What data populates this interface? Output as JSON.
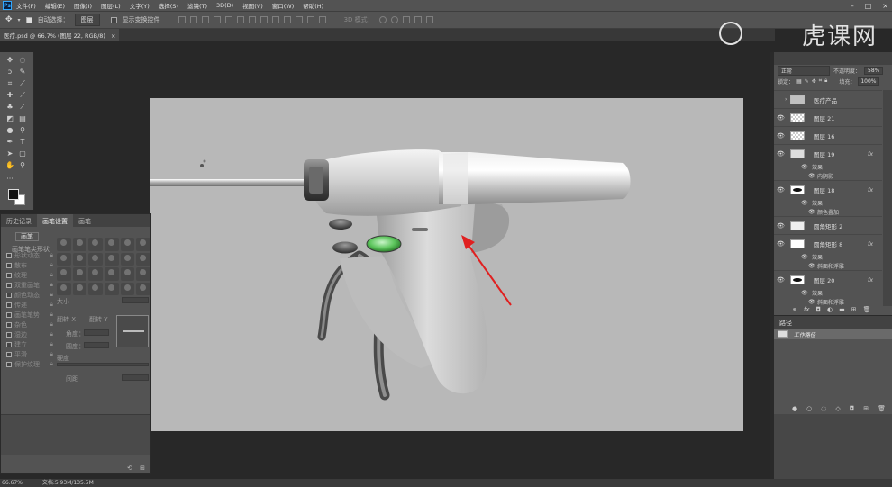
{
  "menu": [
    "文件(F)",
    "编辑(E)",
    "图像(I)",
    "图层(L)",
    "文字(Y)",
    "选择(S)",
    "滤镜(T)",
    "3D(D)",
    "视图(V)",
    "窗口(W)",
    "帮助(H)"
  ],
  "app_logo": "Ps",
  "options": {
    "auto_select_label": "自动选择：",
    "auto_select_value": "图层",
    "show_transform_label": "显示变换控件",
    "mode_3d_label": "3D 模式："
  },
  "document_tab": "医疗.psd @ 66.7% (图层 22, RGB/8)",
  "watermark": "虎课网",
  "brush_panel": {
    "tabs": [
      "历史记录",
      "画笔设置",
      "画笔"
    ],
    "brush_button": "画笔",
    "tip_shape": "画笔笔尖形状",
    "options": [
      "形状动态",
      "散布",
      "纹理",
      "双重画笔",
      "颜色动态",
      "传递",
      "画笔笔势",
      "杂色",
      "湿边",
      "建立",
      "平滑",
      "保护纹理"
    ],
    "size_label": "大小",
    "flip_x": "翻转 X",
    "flip_y": "翻转 Y",
    "angle_label": "角度：",
    "roundness_label": "圆度：",
    "hardness_label": "硬度",
    "spacing_label": "间距"
  },
  "layers_panel": {
    "blend_mode": "正常",
    "opacity_label": "不透明度：",
    "opacity_value": "58%",
    "lock_label": "锁定：",
    "fill_label": "填充：",
    "fill_value": "100%",
    "layers": [
      {
        "name": "医疗产品",
        "type": "folder",
        "eye": false
      },
      {
        "name": "图层 21",
        "type": "checker",
        "eye": true
      },
      {
        "name": "图层 16",
        "type": "checker",
        "eye": true
      },
      {
        "name": "图层 19",
        "type": "light",
        "eye": true,
        "fx": "fx",
        "effects_label": "效果",
        "effect": "内阴影"
      },
      {
        "name": "图层 18",
        "type": "dark",
        "eye": true,
        "fx": "fx",
        "effects_label": "效果",
        "effect": "颜色叠加"
      },
      {
        "name": "圆角矩形 2",
        "type": "light",
        "eye": true
      },
      {
        "name": "圆角矩形 8",
        "type": "light",
        "eye": true,
        "fx": "fx",
        "effects_label": "效果",
        "effect": "斜面和浮雕"
      },
      {
        "name": "图层 20",
        "type": "dark",
        "eye": true,
        "fx": "fx",
        "effects_label": "效果",
        "effect": "斜面和浮雕"
      }
    ]
  },
  "paths_panel": {
    "title": "路径",
    "path_name": "工作路径"
  },
  "status": {
    "zoom": "66.67%",
    "doc": "文档:5.93M/135.5M"
  }
}
